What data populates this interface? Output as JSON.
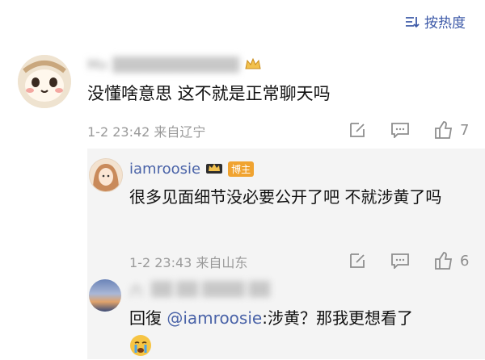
{
  "sort": {
    "label": "按热度"
  },
  "comment": {
    "username_blurred": "Mo",
    "text": "没懂啥意思 这不就是正常聊天吗",
    "time": "1-2 23:42",
    "location": "来自辽宁",
    "likes": "7"
  },
  "replies": [
    {
      "username": "iamroosie",
      "badge": "博主",
      "text": "很多见面细节没必要公开了吧 不就涉黄了吗",
      "time": "1-2 23:43",
      "location": "来自山东",
      "likes": "6"
    },
    {
      "username_blurred": "六",
      "reply_prefix": "回復",
      "mention": "@iamroosie",
      "text": ":涉黄？那我更想看了"
    }
  ],
  "colors": {
    "link": "#4a63a8",
    "badge": "#f0a330",
    "reply_bg": "#f4f4f4"
  }
}
